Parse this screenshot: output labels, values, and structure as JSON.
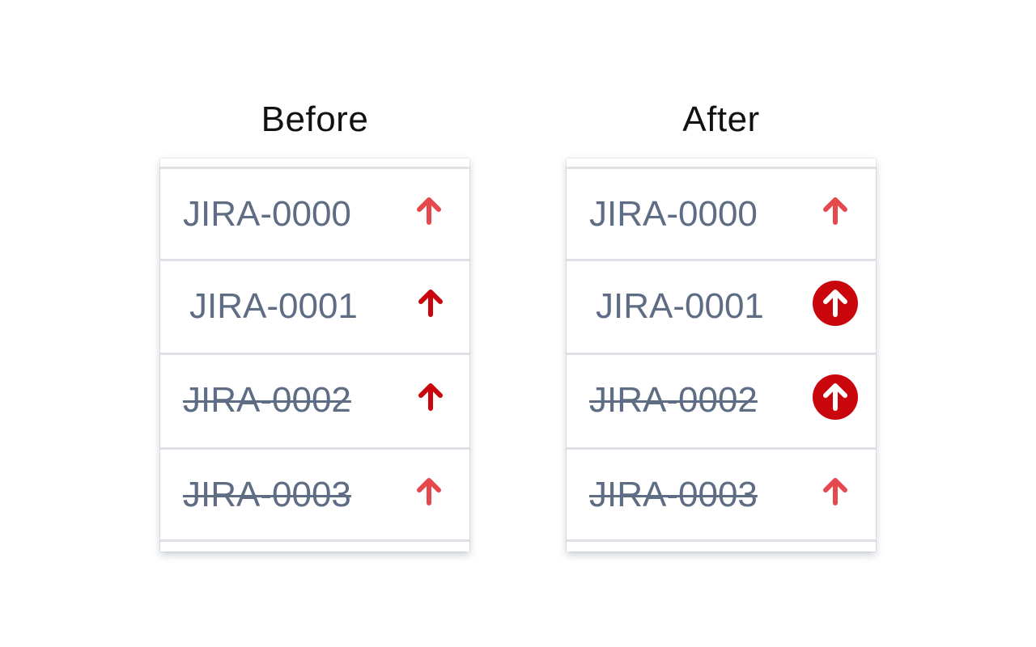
{
  "panels": [
    {
      "title": "Before",
      "rows": [
        {
          "key": "JIRA-0000",
          "done": false,
          "priority_icon": "arrow-up-icon",
          "color": "#e5484d"
        },
        {
          "key": "JIRA-0001",
          "done": false,
          "priority_icon": "arrow-up-icon",
          "color": "#c9060c"
        },
        {
          "key": "JIRA-0002",
          "done": true,
          "priority_icon": "arrow-up-icon",
          "color": "#c9060c"
        },
        {
          "key": "JIRA-0003",
          "done": true,
          "priority_icon": "arrow-up-icon",
          "color": "#e5484d"
        }
      ]
    },
    {
      "title": "After",
      "rows": [
        {
          "key": "JIRA-0000",
          "done": false,
          "priority_icon": "arrow-up-icon",
          "color": "#e5484d"
        },
        {
          "key": "JIRA-0001",
          "done": false,
          "priority_icon": "arrow-up-circle-icon",
          "color": "#c9060c"
        },
        {
          "key": "JIRA-0002",
          "done": true,
          "priority_icon": "arrow-up-circle-icon",
          "color": "#c9060c"
        },
        {
          "key": "JIRA-0003",
          "done": true,
          "priority_icon": "arrow-up-icon",
          "color": "#e5484d"
        }
      ]
    }
  ]
}
